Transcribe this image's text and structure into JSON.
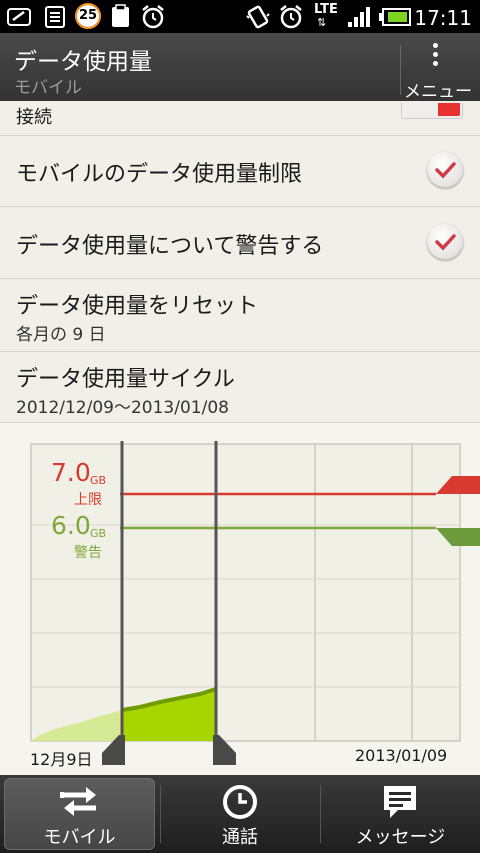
{
  "status_bar": {
    "notification_count": "25",
    "network": "LTE",
    "time": "17:11",
    "icons": [
      "sync-icon",
      "notes-icon",
      "calendar-badge-icon",
      "clipboard-icon",
      "alarm-icon",
      "vibrate-icon",
      "alarm-icon",
      "lte-icon",
      "signal-icon",
      "battery-icon"
    ]
  },
  "header": {
    "title": "データ使用量",
    "subtitle": "モバイル",
    "menu_label": "メニュー"
  },
  "settings": {
    "partial_row": "接続",
    "mobile_limit": "モバイルのデータ使用量制限",
    "mobile_limit_checked": true,
    "warn": "データ使用量について警告する",
    "warn_checked": true,
    "reset_title": "データ使用量をリセット",
    "reset_sub": "各月の 9 日",
    "cycle_title": "データ使用量サイクル",
    "cycle_sub": "2012/12/09～2013/01/08"
  },
  "chart": {
    "limit_value": "7.0",
    "limit_unit": "GB",
    "limit_label": "上限",
    "warning_value": "6.0",
    "warning_unit": "GB",
    "warning_label": "警告",
    "start_date": "12月9日",
    "end_date": "2013/01/09",
    "colors": {
      "limit": "#d83a30",
      "warning": "#7fa83a",
      "usage": "#a8d400",
      "usage_light": "#d6ea95"
    }
  },
  "chart_data": {
    "type": "area",
    "title": "",
    "xlabel": "",
    "ylabel": "",
    "x_start": "12月9日",
    "x_end": "2013/01/09",
    "limit_gb": 7.0,
    "warning_gb": 6.0,
    "ylim": [
      0,
      8.5
    ]
  },
  "tabs": [
    {
      "label": "モバイル",
      "icon": "transfer-arrows-icon",
      "active": true
    },
    {
      "label": "通話",
      "icon": "clock-icon",
      "active": false
    },
    {
      "label": "メッセージ",
      "icon": "message-icon",
      "active": false
    }
  ],
  "theme": {
    "checkmark": "#d23b44",
    "header_bg": "#3d3d3d",
    "list_bg": "#f2efe9"
  }
}
